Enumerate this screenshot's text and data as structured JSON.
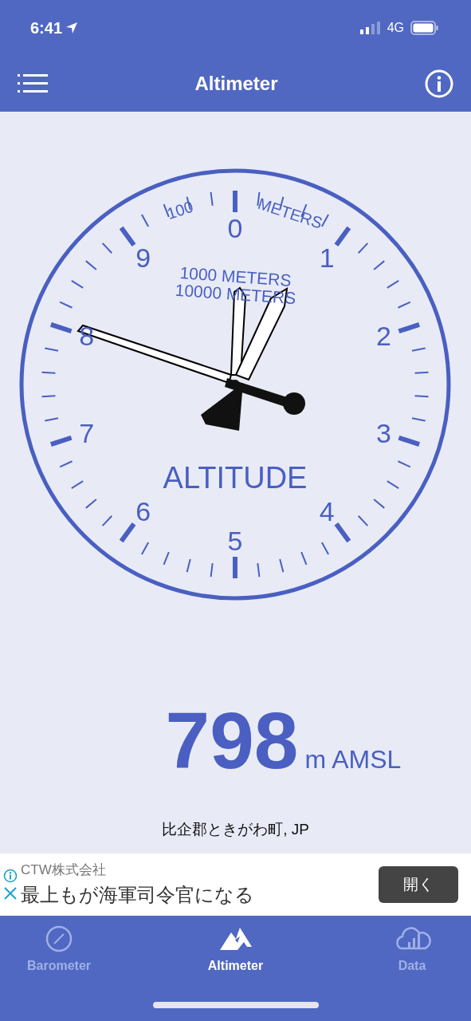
{
  "status_bar": {
    "time": "6:41",
    "network": "4G"
  },
  "header": {
    "title": "Altimeter"
  },
  "dial": {
    "numbers": [
      "0",
      "1",
      "2",
      "3",
      "4",
      "5",
      "6",
      "7",
      "8",
      "9"
    ],
    "scale_labels": [
      {
        "kind": "hundred",
        "text": "100"
      },
      {
        "kind": "meters",
        "text": "METERS"
      },
      {
        "kind": "thousand",
        "text": "1000 METERS"
      },
      {
        "kind": "tenthousand",
        "text": "10000 METERS"
      }
    ],
    "title": "ALTITUDE"
  },
  "readout": {
    "value": "798",
    "unit": "m AMSL"
  },
  "location": "比企郡ときがわ町, JP",
  "ad": {
    "advertiser": "CTW株式会社",
    "headline": "最上もが海軍司令官になる",
    "button": "開く"
  },
  "tabs": [
    {
      "label": "Barometer",
      "kind": "gauge",
      "selected": false
    },
    {
      "label": "Altimeter",
      "kind": "mountain",
      "selected": true
    },
    {
      "label": "Data",
      "kind": "cloud",
      "selected": false
    }
  ]
}
